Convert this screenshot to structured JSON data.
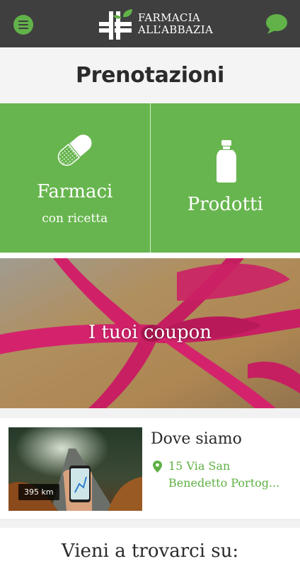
{
  "header": {
    "brand_line1": "FARMACIA",
    "brand_line2": "ALL’ABBAZIA",
    "menu_icon": "hamburger-menu-icon",
    "chat_icon": "speech-bubble-icon",
    "background_color": "#3f3f3f",
    "accent_color": "#62b24a"
  },
  "page": {
    "title": "Prenotazioni"
  },
  "tiles": [
    {
      "label": "Farmaci",
      "sublabel": "con ricetta",
      "icon": "pill-capsule-icon"
    },
    {
      "label": "Prodotti",
      "sublabel": "",
      "icon": "bottle-icon"
    }
  ],
  "tile_color": "#67b54e",
  "coupon": {
    "label": "I tuoi coupon"
  },
  "location": {
    "title": "Dove siamo",
    "address": "15 Via San Benedetto Portog...",
    "distance": "395 km",
    "pin_icon": "map-pin-icon",
    "address_color": "#5fb044"
  },
  "visit": {
    "title": "Vieni a trovarci su:"
  }
}
